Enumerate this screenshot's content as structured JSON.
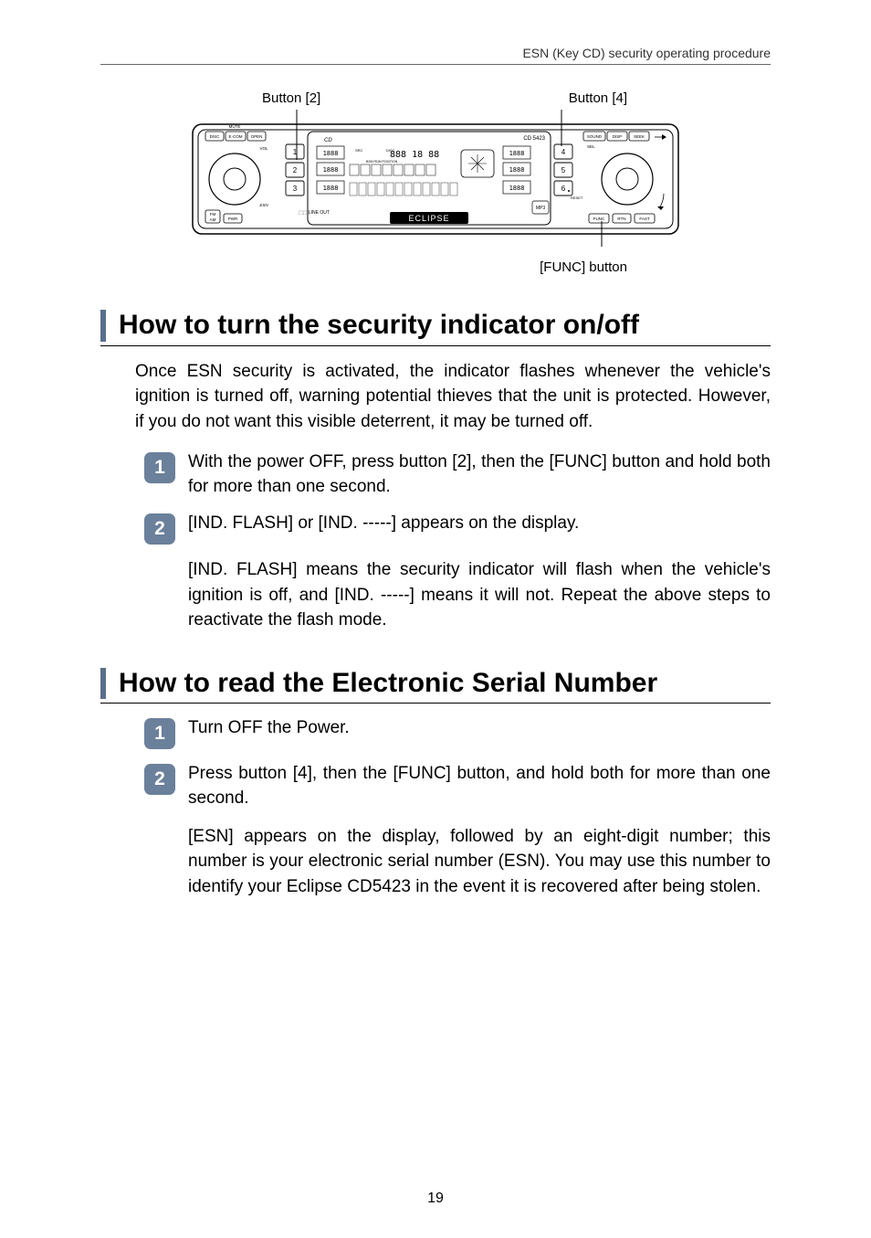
{
  "header": {
    "running_head": "ESN (Key CD) security operating procedure"
  },
  "diagram": {
    "button2_label": "Button [2]",
    "button4_label": "Button [4]",
    "func_label": "[FUNC] button",
    "brand": "ECLIPSE",
    "model": "CD 5423",
    "face_buttons_left": [
      "DISC",
      "E•COM",
      "OPEN",
      "MUTE",
      "VOL",
      "ESN",
      "FM",
      "AM",
      "PWR"
    ],
    "face_buttons_right": [
      "SOUND",
      "DISP",
      "SEEK",
      "SEL",
      "RESET",
      "FUNC",
      "RTN",
      "FAST"
    ],
    "preset_left": [
      "1",
      "2",
      "3"
    ],
    "preset_right": [
      "4",
      "5",
      "6"
    ],
    "line_out": "LINE OUT",
    "cd_icon": "CD"
  },
  "sections": [
    {
      "heading": "How to turn the security indicator on/off",
      "intro": "Once ESN security is activated, the indicator flashes whenever the vehicle's ignition is turned off, warning potential thieves that the unit is protected. However, if you do not want this visible deterrent, it may be turned off.",
      "steps": [
        {
          "num": "1",
          "text": "With the power OFF, press button [2], then the [FUNC] button and hold both for more than one second."
        },
        {
          "num": "2",
          "text": "[IND. FLASH] or [IND. -----] appears on the display.",
          "note": "[IND. FLASH] means the security indicator will flash when the vehicle's ignition is off, and [IND. -----] means it will not. Repeat the above steps to reactivate the flash mode."
        }
      ]
    },
    {
      "heading": "How to read the Electronic Serial Number",
      "steps": [
        {
          "num": "1",
          "text": "Turn OFF the Power."
        },
        {
          "num": "2",
          "text": "Press button [4], then the [FUNC] button, and hold both for more than one second.",
          "note": "[ESN] appears on the display, followed by an eight-digit number; this number is your electronic serial number (ESN). You may use this number to identify your Eclipse CD5423 in the event it is recovered after being stolen."
        }
      ]
    }
  ],
  "page_number": "19"
}
